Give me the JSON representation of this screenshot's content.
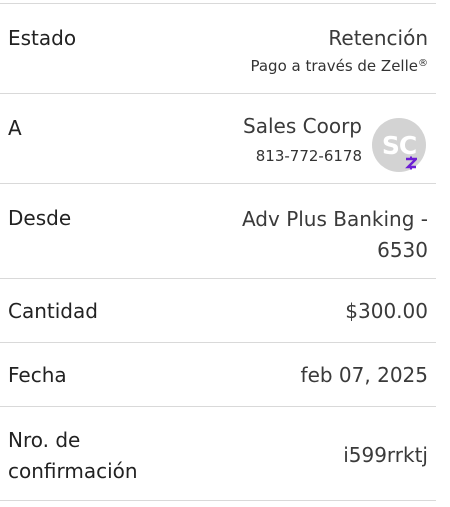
{
  "rows": {
    "estado": {
      "label": "Estado",
      "value": "Retención",
      "sub_text": "Pago a través de Zelle",
      "sub_mark": "®"
    },
    "a": {
      "label": "A",
      "name": "Sales Coorp",
      "phone": "813-772-6178",
      "avatar_initials": "SC",
      "badge_icon": "zelle-z-icon",
      "badge_color": "#6d1ed4",
      "avatar_color": "#d3d3d3"
    },
    "desde": {
      "label": "Desde",
      "value_line1": "Adv Plus Banking -",
      "value_line2": "6530"
    },
    "cantidad": {
      "label": "Cantidad",
      "value": "$300.00"
    },
    "fecha": {
      "label": "Fecha",
      "value": "feb 07, 2025"
    },
    "confirmacion": {
      "label_line1": "Nro. de",
      "label_line2": "confirmación",
      "value": "i599rrktj"
    }
  }
}
